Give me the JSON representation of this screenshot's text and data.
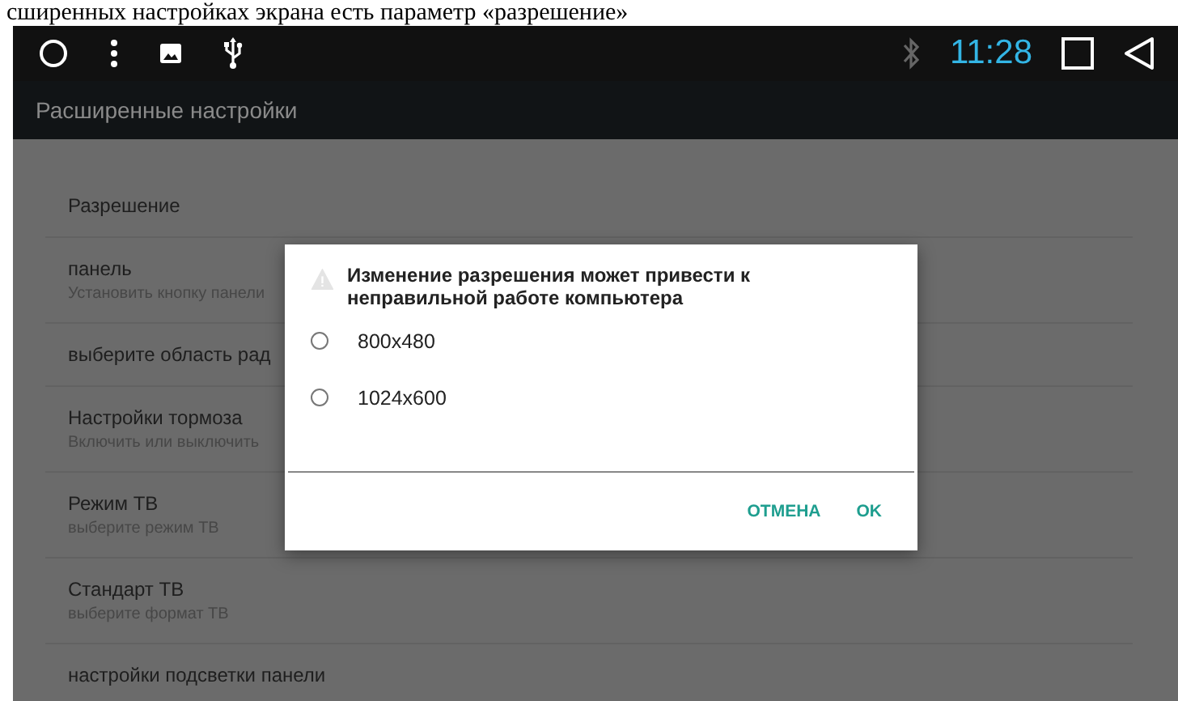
{
  "caption": "сширенных настройках экрана есть параметр «разрешение»",
  "status_bar": {
    "time": "11:28"
  },
  "action_bar": {
    "title": "Расширенные настройки"
  },
  "settings": [
    {
      "title": "Разрешение"
    },
    {
      "title": "панель",
      "summary": "Установить кнопку панели"
    },
    {
      "title": "выберите область рад"
    },
    {
      "title": "Настройки тормоза",
      "summary": "Включить или выключить"
    },
    {
      "title": "Режим ТВ",
      "summary": "выберите режим ТВ"
    },
    {
      "title": "Стандарт ТВ",
      "summary": "выберите формат ТВ"
    },
    {
      "title": "настройки подсветки панели"
    }
  ],
  "dialog": {
    "message": "Изменение разрешения может привести к неправильной работе компьютера",
    "options": [
      {
        "label": "800x480",
        "selected": false
      },
      {
        "label": "1024x600",
        "selected": false
      }
    ],
    "buttons": [
      "ОТМЕНА",
      "OK"
    ]
  }
}
